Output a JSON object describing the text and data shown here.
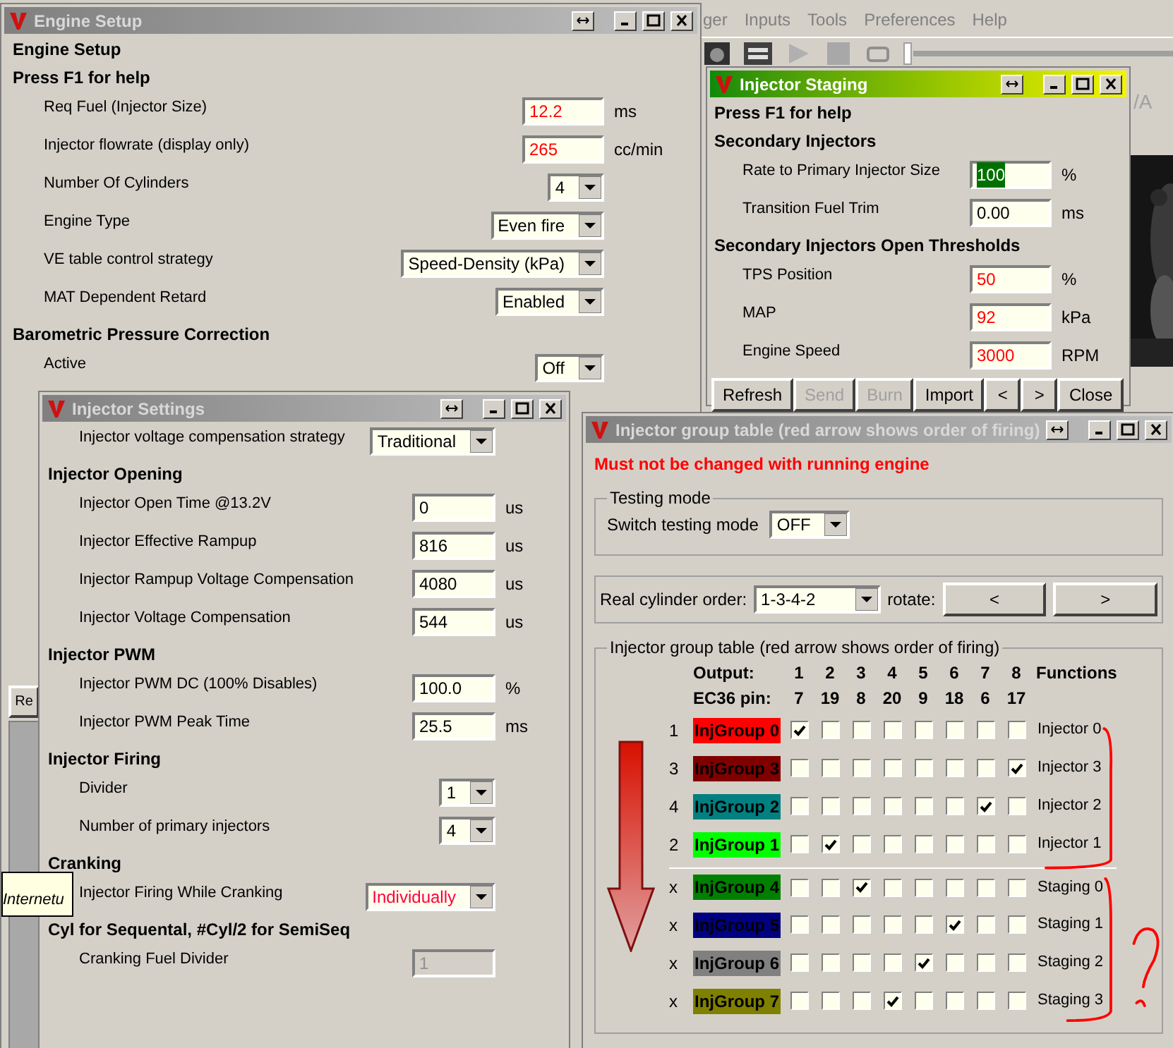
{
  "app": {
    "menu": [
      "ger",
      "Inputs",
      "Tools",
      "Preferences",
      "Help"
    ],
    "tab_fragment": "/A"
  },
  "engine_setup": {
    "title": "Engine Setup",
    "active": false,
    "items": [
      {
        "kind": "heading",
        "text": "Engine Setup"
      },
      {
        "kind": "heading",
        "text": "Press F1 for help"
      },
      {
        "kind": "field",
        "label": "Req Fuel (Injector Size)",
        "value": "12.2",
        "unit": "ms",
        "emphasized": true
      },
      {
        "kind": "field",
        "label": "Injector flowrate (display only)",
        "value": "265",
        "unit": "cc/min",
        "emphasized": true
      },
      {
        "kind": "select",
        "label": "Number Of Cylinders",
        "value": "4"
      },
      {
        "kind": "select",
        "label": "Engine Type",
        "value": "Even fire"
      },
      {
        "kind": "select",
        "label": "VE table control strategy",
        "value": "Speed-Density (kPa)"
      },
      {
        "kind": "select",
        "label": "MAT Dependent Retard",
        "value": "Enabled"
      },
      {
        "kind": "heading",
        "text": "Barometric Pressure Correction"
      },
      {
        "kind": "select",
        "label": "Active",
        "value": "Off"
      }
    ],
    "partial_button": "Re"
  },
  "injector_staging": {
    "title": "Injector Staging",
    "active": true,
    "items": [
      {
        "kind": "heading",
        "text": "Press F1 for help"
      },
      {
        "kind": "heading",
        "text": "Secondary Injectors"
      },
      {
        "kind": "field",
        "label": "Rate to Primary Injector Size",
        "value": "100",
        "unit": "%",
        "text_selected": true
      },
      {
        "kind": "field",
        "label": "Transition Fuel Trim",
        "value": "0.00",
        "unit": "ms",
        "text_selected": false
      },
      {
        "kind": "heading",
        "text": "Secondary Injectors Open Thresholds"
      },
      {
        "kind": "field",
        "label": "TPS Position",
        "value": "50",
        "unit": "%",
        "emphasized": true,
        "text_selected": false
      },
      {
        "kind": "field",
        "label": "MAP",
        "value": "92",
        "unit": "kPa",
        "emphasized": true,
        "text_selected": false
      },
      {
        "kind": "field",
        "label": "Engine Speed",
        "value": "3000",
        "unit": "RPM",
        "emphasized": true,
        "text_selected": false
      }
    ],
    "buttons": [
      {
        "label": "Refresh",
        "disabled": false
      },
      {
        "label": "Send",
        "disabled": true
      },
      {
        "label": "Burn",
        "disabled": true
      },
      {
        "label": "Import",
        "disabled": false
      },
      {
        "label": "<",
        "disabled": false
      },
      {
        "label": ">",
        "disabled": false
      },
      {
        "label": "Close",
        "disabled": false
      }
    ]
  },
  "injector_settings": {
    "title": "Injector Settings",
    "active": false,
    "items": [
      {
        "kind": "select",
        "label": "Injector voltage compensation strategy",
        "value": "Traditional"
      },
      {
        "kind": "heading",
        "text": "Injector Opening"
      },
      {
        "kind": "field",
        "label": "Injector Open Time @13.2V",
        "value": "0",
        "unit": "us"
      },
      {
        "kind": "field",
        "label": "Injector Effective Rampup",
        "value": "816",
        "unit": "us"
      },
      {
        "kind": "field",
        "label": "Injector Rampup Voltage Compensation",
        "value": "4080",
        "unit": "us"
      },
      {
        "kind": "field",
        "label": "Injector Voltage Compensation",
        "value": "544",
        "unit": "us"
      },
      {
        "kind": "heading",
        "text": "Injector PWM"
      },
      {
        "kind": "field",
        "label": "Injector PWM DC (100% Disables)",
        "value": "100.0",
        "unit": "%"
      },
      {
        "kind": "field",
        "label": "Injector PWM Peak Time",
        "value": "25.5",
        "unit": "ms"
      },
      {
        "kind": "heading",
        "text": "Injector Firing"
      },
      {
        "kind": "select",
        "label": "Divider",
        "value": "1"
      },
      {
        "kind": "select",
        "label": "Number of primary injectors",
        "value": "4"
      },
      {
        "kind": "heading",
        "text": "Cranking"
      },
      {
        "kind": "select",
        "label": "Injector Firing While Cranking",
        "value": "Individually",
        "emphasized": true
      },
      {
        "kind": "heading",
        "text": "Cyl for Sequental, #Cyl/2 for SemiSeq"
      },
      {
        "kind": "field",
        "label": "Cranking Fuel Divider",
        "value": "1",
        "disabled": true
      }
    ]
  },
  "tooltip": "Internetu",
  "injector_group_table": {
    "title": "Injector group table (red arrow shows order of firing)",
    "active": false,
    "warning": "Must not be changed with running engine",
    "testing_mode": {
      "legend": "Testing mode",
      "label": "Switch testing mode",
      "value": "OFF"
    },
    "cylinder_order": {
      "label": "Real cylinder order:",
      "value": "1-3-4-2",
      "rotate_label": "rotate:",
      "buttons": [
        "<",
        ">"
      ]
    },
    "table": {
      "legend": "Injector group table (red arrow shows order of firing)",
      "output_label": "Output:",
      "outputs": [
        "1",
        "2",
        "3",
        "4",
        "5",
        "6",
        "7",
        "8"
      ],
      "pin_label": "EC36 pin:",
      "pins": [
        "7",
        "19",
        "8",
        "20",
        "9",
        "18",
        "6",
        "17"
      ],
      "functions_label": "Functions",
      "rows": [
        {
          "order": "1",
          "name": "InjGroup 0",
          "color": "#ff0000",
          "checks": [
            true,
            false,
            false,
            false,
            false,
            false,
            false,
            false
          ],
          "function": "Injector 0"
        },
        {
          "order": "3",
          "name": "InjGroup 3",
          "color": "#800000",
          "checks": [
            false,
            false,
            false,
            false,
            false,
            false,
            false,
            true
          ],
          "function": "Injector 3"
        },
        {
          "order": "4",
          "name": "InjGroup 2",
          "color": "#008080",
          "checks": [
            false,
            false,
            false,
            false,
            false,
            false,
            true,
            false
          ],
          "function": "Injector 2"
        },
        {
          "order": "2",
          "name": "InjGroup 1",
          "color": "#00ff00",
          "checks": [
            false,
            true,
            false,
            false,
            false,
            false,
            false,
            false
          ],
          "function": "Injector 1"
        },
        {
          "order": "x",
          "name": "InjGroup 4",
          "color": "#008000",
          "checks": [
            false,
            false,
            true,
            false,
            false,
            false,
            false,
            false
          ],
          "function": "Staging 0"
        },
        {
          "order": "x",
          "name": "InjGroup 5",
          "color": "#000080",
          "checks": [
            false,
            false,
            false,
            false,
            false,
            true,
            false,
            false
          ],
          "function": "Staging 1"
        },
        {
          "order": "x",
          "name": "InjGroup 6",
          "color": "#808080",
          "checks": [
            false,
            false,
            false,
            false,
            true,
            false,
            false,
            false
          ],
          "function": "Staging 2"
        },
        {
          "order": "x",
          "name": "InjGroup 7",
          "color": "#808000",
          "checks": [
            false,
            false,
            false,
            true,
            false,
            false,
            false,
            false
          ],
          "function": "Staging 3"
        }
      ]
    }
  }
}
